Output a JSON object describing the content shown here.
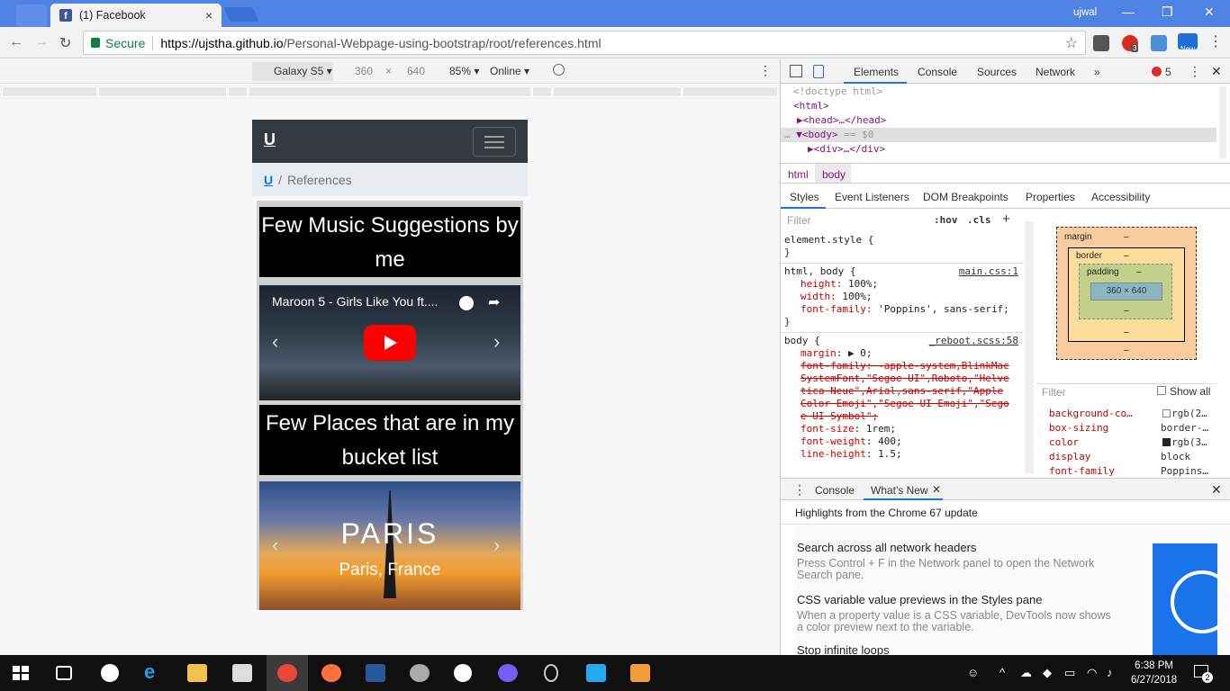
{
  "browser": {
    "tab_title": "(1) Facebook",
    "tab_close": "×",
    "user": "ujwal",
    "window_minimize": "—",
    "window_restore": "❐",
    "window_close": "✕",
    "secure_label": "Secure",
    "url_host": "https://ujstha.github.io",
    "url_path": "/Personal-Webpage-using-bootstrap/root/references.html",
    "back": "←",
    "forward": "→",
    "reload": "↻",
    "bookmark": "☆",
    "ext_badge": "3",
    "ext_new": "New"
  },
  "device_toolbar": {
    "device": "Galaxy S5 ▾",
    "width": "360",
    "x": "×",
    "height": "640",
    "zoom": "85% ▾",
    "network": "Online ▾",
    "more": "⋮"
  },
  "page": {
    "brand": "U",
    "breadcrumb_home": "U",
    "breadcrumb_sep": "/",
    "breadcrumb_current": "References",
    "music_heading": "Few Music Suggestions by me",
    "video_title": "Maroon 5 - Girls Like You ft....",
    "places_heading": "Few Places that are in my bucket list",
    "paris_title": "PARIS",
    "paris_caption": "Paris, France",
    "prev": "‹",
    "next": "›"
  },
  "devtools": {
    "tabs": [
      "Elements",
      "Console",
      "Sources",
      "Network",
      "»"
    ],
    "error_count": "5",
    "menu": "⋮",
    "close": "✕",
    "dom": {
      "doctype": "<!doctype html>",
      "html": "<html>",
      "head": "▶<head>…</head>",
      "body": "▼<body>",
      "body_eq": " == $0",
      "div": "▶<div>…</div>",
      "dots": "…"
    },
    "crumbs": [
      "html",
      "body"
    ],
    "subtabs": [
      "Styles",
      "Event Listeners",
      "DOM Breakpoints",
      "Properties",
      "Accessibility"
    ],
    "filter_placeholder": "Filter",
    "hov": ":hov",
    "cls": ".cls",
    "plus": "+",
    "styles": {
      "element_style": "element.style {",
      "close_brace": "}",
      "rule1_selector": "html, body {",
      "rule1_src": "main.css:1",
      "rule1_props": [
        {
          "p": "height",
          "v": "100%;"
        },
        {
          "p": "width",
          "v": "100%;"
        },
        {
          "p": "font-family",
          "v": "'Poppins', sans-serif;"
        }
      ],
      "rule2_selector": "body {",
      "rule2_src": "_reboot.scss:58",
      "margin": "margin",
      "margin_v": ": ▶ 0;",
      "font_family_struck": "font-family: -apple-system,BlinkMacSystemFont,\"Segoe UI\",Roboto,\"Helvetica Neue\",Arial,sans-serif,\"Apple Color Emoji\",\"Segoe UI Emoji\",\"Segoe UI Symbol\";",
      "font_size": "font-size",
      "font_size_v": ": 1rem;",
      "font_weight": "font-weight",
      "font_weight_v": ": 400;",
      "line_height": "line-height",
      "line_height_v": ": 1.5;"
    },
    "box_model": {
      "margin": "margin",
      "border": "border",
      "padding": "padding",
      "dash": "–",
      "content": "360 × 640"
    },
    "computed_filter": "Filter",
    "show_all": "Show all",
    "computed": [
      {
        "name": "background-co…",
        "value": "rgb(2…",
        "swatch": "#ffffff"
      },
      {
        "name": "box-sizing",
        "value": "border-…",
        "swatch": ""
      },
      {
        "name": "color",
        "value": "rgb(3…",
        "swatch": "#212529"
      },
      {
        "name": "display",
        "value": "block",
        "swatch": ""
      },
      {
        "name": "font-family",
        "value": "Poppins…",
        "swatch": ""
      }
    ],
    "drawer_tabs": [
      "Console",
      "What's New"
    ],
    "drawer_close_tab": "✕",
    "highlights": "Highlights from the Chrome 67 update",
    "whats_new": [
      {
        "title": "Search across all network headers",
        "desc": "Press Control + F in the Network panel to open the Network Search pane."
      },
      {
        "title": "CSS variable value previews in the Styles pane",
        "desc": "When a property value is a CSS variable, DevTools now shows a color preview next to the variable."
      },
      {
        "title": "Stop infinite loops",
        "desc": ""
      }
    ]
  },
  "taskbar": {
    "time": "6:38 PM",
    "date": "6/27/2018",
    "notif_count": "2",
    "colors": {
      "chrome": "#e8453c",
      "firefox": "#ff7139",
      "word": "#2b579a",
      "vscode": "#23a9f2",
      "sublime": "#f49d37",
      "viber": "#7360f2"
    }
  },
  "colors": {
    "chrome_blue": "#4f82e3",
    "navbar": "#343a40",
    "link": "#007bff",
    "devtools_accent": "#1a73e8"
  }
}
